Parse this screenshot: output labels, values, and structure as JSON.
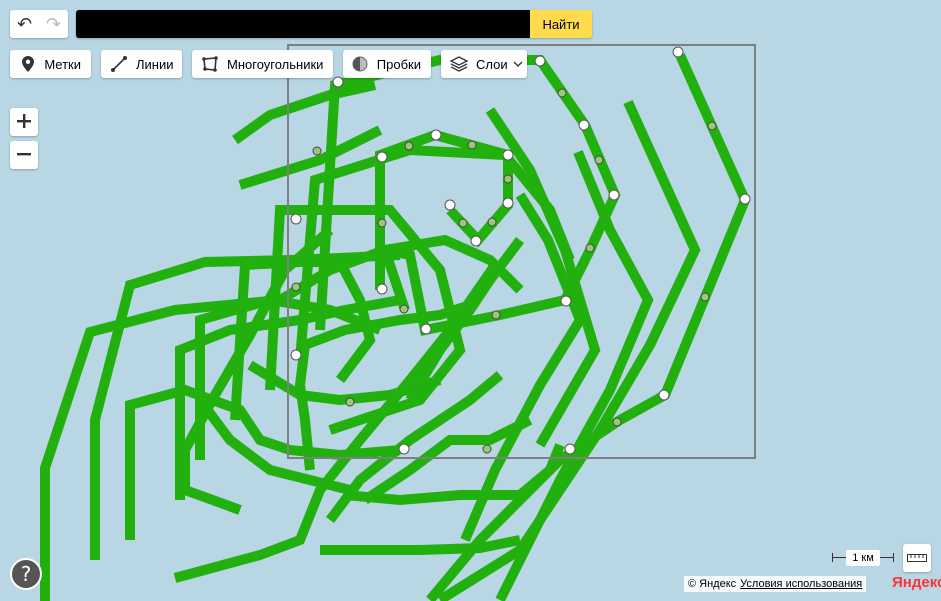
{
  "history": {
    "undo_icon": "undo-icon",
    "redo_icon": "redo-icon"
  },
  "search": {
    "value": "",
    "placeholder": "",
    "button_label": "Найти"
  },
  "toolbar": {
    "placemarks": {
      "label": "Метки",
      "icon": "pin-icon"
    },
    "lines": {
      "label": "Линии",
      "icon": "line-icon"
    },
    "polygons": {
      "label": "Многоугольники",
      "icon": "polygon-icon"
    },
    "traffic": {
      "label": "Пробки",
      "icon": "traffic-icon"
    },
    "layers": {
      "label": "Слои",
      "icon": "layers-icon"
    }
  },
  "zoom": {
    "in_label": "+",
    "out_label": "−"
  },
  "help": {
    "label": "?"
  },
  "scale": {
    "label": "1 км"
  },
  "copyright": {
    "text": "© Яндекс",
    "terms_link": "Условия использования",
    "logo": "Яндекс"
  },
  "colors": {
    "map_water": "#b8d6e4",
    "route_green": "#22b00e",
    "search_button": "#ffdb4d"
  }
}
